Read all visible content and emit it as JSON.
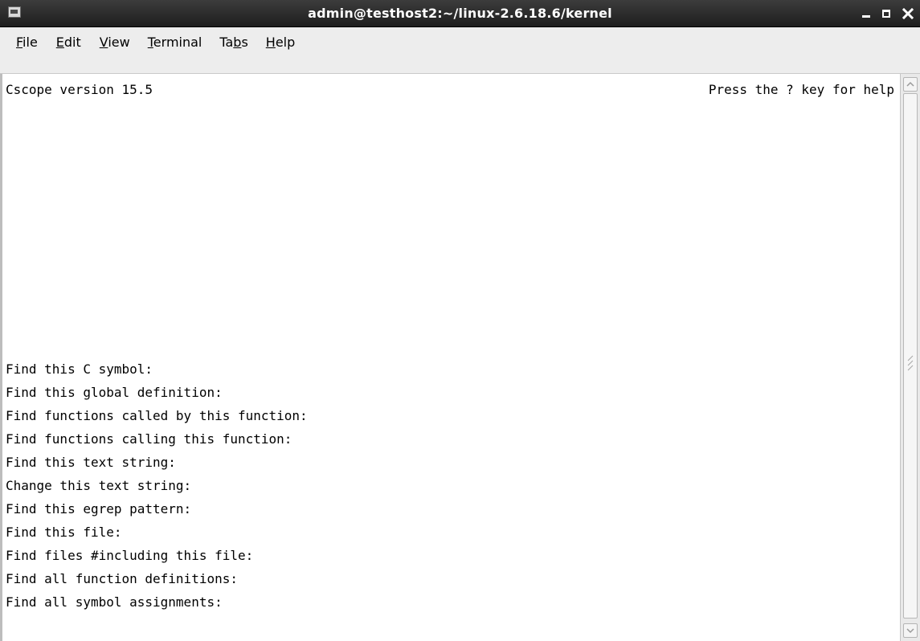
{
  "window": {
    "title": "admin@testhost2:~/linux-2.6.18.6/kernel",
    "controls": {
      "minimize_icon": "minimize-icon",
      "maximize_icon": "maximize-icon",
      "close_icon": "close-icon"
    }
  },
  "menu": {
    "items": [
      {
        "pre": "",
        "ul": "F",
        "post": "ile"
      },
      {
        "pre": "",
        "ul": "E",
        "post": "dit"
      },
      {
        "pre": "",
        "ul": "V",
        "post": "iew"
      },
      {
        "pre": "",
        "ul": "T",
        "post": "erminal"
      },
      {
        "pre": "Ta",
        "ul": "b",
        "post": "s"
      },
      {
        "pre": "",
        "ul": "H",
        "post": "elp"
      }
    ]
  },
  "terminal": {
    "header_left": "Cscope version 15.5",
    "header_right": "Press the ? key for help",
    "prompts": [
      "Find this C symbol:",
      "Find this global definition:",
      "Find functions called by this function:",
      "Find functions calling this function:",
      "Find this text string:",
      "Change this text string:",
      "Find this egrep pattern:",
      "Find this file:",
      "Find files #including this file:",
      "Find all function definitions:",
      "Find all symbol assignments:"
    ]
  },
  "colors": {
    "titlebar": "#2a2a2a",
    "menubar": "#ededed",
    "terminal_bg": "#ffffff",
    "text": "#000000"
  }
}
